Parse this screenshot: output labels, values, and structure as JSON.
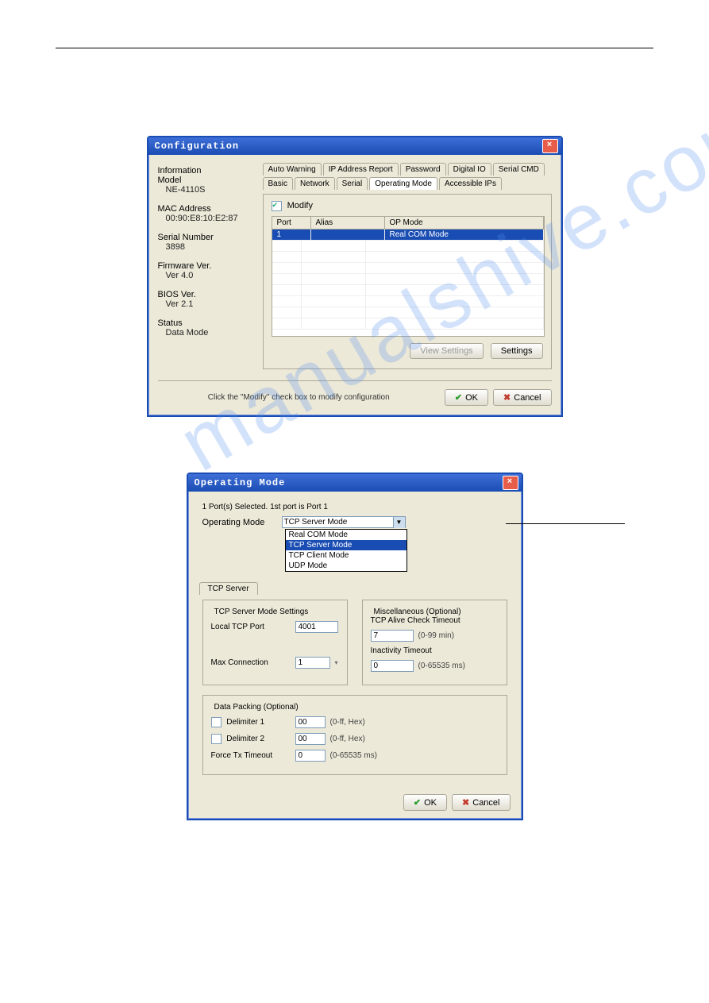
{
  "win1": {
    "title": "Configuration",
    "info": {
      "heading": "Information",
      "model": {
        "label": "Model",
        "value": "NE-4110S"
      },
      "mac": {
        "label": "MAC Address",
        "value": "00:90:E8:10:E2:87"
      },
      "serial": {
        "label": "Serial Number",
        "value": "3898"
      },
      "firmware": {
        "label": "Firmware Ver.",
        "value": "Ver 4.0"
      },
      "bios": {
        "label": "BIOS Ver.",
        "value": "Ver 2.1"
      },
      "status": {
        "label": "Status",
        "value": "Data Mode"
      }
    },
    "tabs_row1": [
      "Auto Warning",
      "IP Address Report",
      "Password",
      "Digital IO",
      "Serial CMD"
    ],
    "tabs_row2": [
      "Basic",
      "Network",
      "Serial",
      "Operating Mode",
      "Accessible IPs"
    ],
    "active_tab": "Operating Mode",
    "modify_label": "Modify",
    "cols": {
      "port": "Port",
      "alias": "Alias",
      "op": "OP Mode"
    },
    "row1": {
      "port": "1",
      "alias": "",
      "op": "Real COM Mode"
    },
    "btn_view": "View Settings",
    "btn_settings": "Settings",
    "footer_msg": "Click the \"Modify\" check box to modify configuration",
    "btn_ok": "OK",
    "btn_cancel": "Cancel"
  },
  "win2": {
    "title": "Operating Mode",
    "top_msg": "1 Port(s) Selected. 1st port is Port 1",
    "op_label": "Operating Mode",
    "selected_mode": "TCP Server Mode",
    "dropdown": [
      "Real COM Mode",
      "TCP Server Mode",
      "TCP Client Mode",
      "UDP Mode"
    ],
    "inner_tab": "TCP Server",
    "fs_settings": {
      "legend": "TCP Server Mode Settings",
      "local_port_label": "Local TCP Port",
      "local_port_value": "4001",
      "max_conn_label": "Max Connection",
      "max_conn_value": "1"
    },
    "fs_misc": {
      "legend": "Miscellaneous (Optional)",
      "alive_label": "TCP Alive Check Timeout",
      "alive_value": "7",
      "alive_hint": "(0-99 min)",
      "inact_label": "Inactivity Timeout",
      "inact_value": "0",
      "inact_hint": "(0-65535 ms)"
    },
    "fs_packing": {
      "legend": "Data Packing (Optional)",
      "del1_label": "Delimiter 1",
      "del1_value": "00",
      "hex_hint": "(0-ff, Hex)",
      "del2_label": "Delimiter 2",
      "del2_value": "00",
      "force_label": "Force Tx Timeout",
      "force_value": "0",
      "force_hint": "(0-65535 ms)"
    },
    "btn_ok": "OK",
    "btn_cancel": "Cancel"
  }
}
